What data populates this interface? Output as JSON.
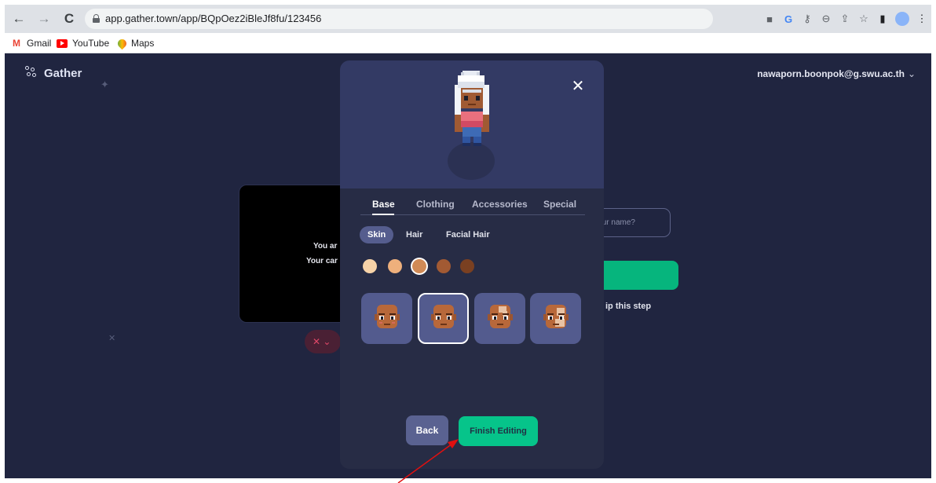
{
  "browser": {
    "url": "app.gather.town/app/BQpOez2iBleJf8fu/123456",
    "bookmarks": [
      {
        "label": "Gmail",
        "icon": "gmail-icon"
      },
      {
        "label": "YouTube",
        "icon": "youtube-icon"
      },
      {
        "label": "Maps",
        "icon": "maps-icon"
      }
    ]
  },
  "app": {
    "logo_text": "Gather",
    "user_email": "nawaporn.boonpok@g.swu.ac.th",
    "background": {
      "video_text_line1": "You ar",
      "video_text_line2": "Your car",
      "name_placeholder": "ur name?",
      "skip_text": "ip this step"
    }
  },
  "modal": {
    "tabs": [
      {
        "label": "Base",
        "active": true
      },
      {
        "label": "Clothing",
        "active": false
      },
      {
        "label": "Accessories",
        "active": false
      },
      {
        "label": "Special",
        "active": false
      }
    ],
    "subtabs": [
      {
        "label": "Skin",
        "active": true
      },
      {
        "label": "Hair",
        "active": false
      },
      {
        "label": "Facial Hair",
        "active": false
      }
    ],
    "skin_swatches": [
      "#f7d3a8",
      "#eeb07c",
      "#d08a56",
      "#a25a33",
      "#7a4021"
    ],
    "selected_swatch": 2,
    "face_options_selected": 1,
    "back_label": "Back",
    "finish_label": "Finish Editing"
  },
  "colors": {
    "page_bg": "#202540",
    "modal_bg": "#272c45",
    "modal_head_bg": "#333a64",
    "accent_green": "#06c48a",
    "annotation_arrow": "#e01010"
  }
}
